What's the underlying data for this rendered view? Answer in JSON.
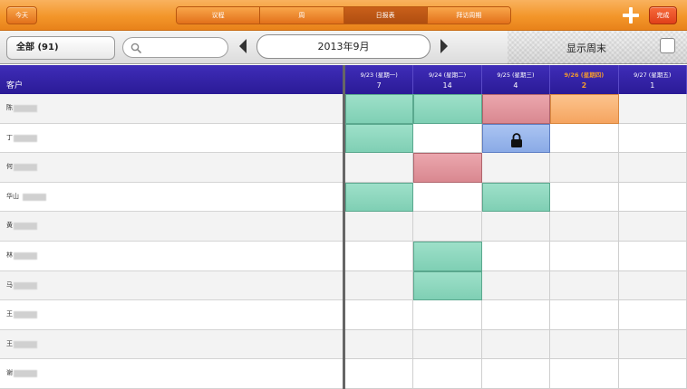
{
  "topbar": {
    "today_label": "今天",
    "done_label": "完成",
    "tabs": [
      {
        "label": "议程",
        "active": false
      },
      {
        "label": "周",
        "active": false
      },
      {
        "label": "日报表",
        "active": true
      },
      {
        "label": "拜访周期",
        "active": false
      }
    ]
  },
  "toolbar": {
    "all_label": "全部 (91)",
    "search_value": "",
    "search_placeholder": "",
    "month_label": "2013年9月",
    "show_weekend_label": "显示周末"
  },
  "customers": {
    "header": "客户",
    "rows": [
      {
        "name": "陈"
      },
      {
        "name": "丁"
      },
      {
        "name": "何"
      },
      {
        "name": "华山"
      },
      {
        "name": "黄"
      },
      {
        "name": "林"
      },
      {
        "name": "马"
      },
      {
        "name": "王"
      },
      {
        "name": "王"
      },
      {
        "name": "谢"
      }
    ]
  },
  "calendar": {
    "days": [
      {
        "label": "9/23 (星期一)",
        "count": "7",
        "today": false
      },
      {
        "label": "9/24 (星期二)",
        "count": "14",
        "today": false
      },
      {
        "label": "9/25 (星期三)",
        "count": "4",
        "today": false
      },
      {
        "label": "9/26 (星期四)",
        "count": "2",
        "today": true
      },
      {
        "label": "9/27 (星期五)",
        "count": "1",
        "today": false
      }
    ],
    "cells": [
      [
        "green",
        "green",
        "red",
        "orange",
        ""
      ],
      [
        "green",
        "",
        "blue-locked",
        "",
        ""
      ],
      [
        "",
        "red",
        "",
        "",
        ""
      ],
      [
        "green",
        "",
        "green",
        "",
        ""
      ],
      [
        "",
        "",
        "",
        "",
        ""
      ],
      [
        "",
        "green",
        "",
        "",
        ""
      ],
      [
        "",
        "green",
        "",
        "",
        ""
      ],
      [
        "",
        "",
        "",
        "",
        ""
      ],
      [
        "",
        "",
        "",
        "",
        ""
      ],
      [
        "",
        "",
        "",
        "",
        ""
      ]
    ]
  },
  "colors": {
    "accent_orange": "#f3962a",
    "header_purple": "#2f1fa4",
    "visit_green": "#8fd8be",
    "visit_red": "#e0959c",
    "visit_orange": "#f8b070",
    "visit_blue": "#98b6ec",
    "today_highlight": "#f39a2e"
  }
}
